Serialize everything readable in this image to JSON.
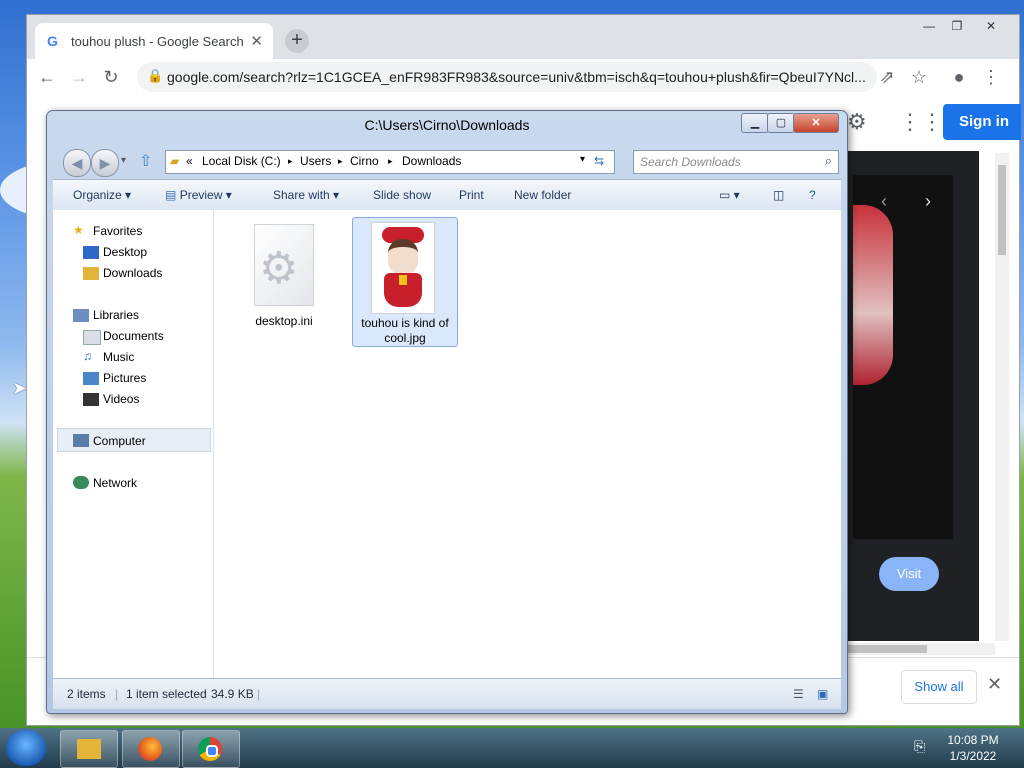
{
  "browser": {
    "tab_title": "touhou plush - Google Search",
    "tab_close": "✕",
    "new_tab": "+",
    "url": "google.com/search?rlz=1C1GCEA_enFR983FR983&source=univ&tbm=isch&q=touhou+plush&fir=QbeuI7YNcl...",
    "sign_in": "Sign in",
    "visit_button": "Visit",
    "show_all": "Show all",
    "download_close": "✕"
  },
  "explorer": {
    "title": "C:\\Users\\Cirno\\Downloads",
    "breadcrumb": [
      "Local Disk (C:)",
      "Users",
      "Cirno",
      "Downloads"
    ],
    "breadcrumb_sep": "▸",
    "breadcrumb_prefix": "«",
    "search_placeholder": "Search Downloads",
    "toolbar": {
      "organize": "Organize ▾",
      "preview": "Preview ▾",
      "share_with": "Share with ▾",
      "slide_show": "Slide show",
      "print": "Print",
      "new_folder": "New folder"
    },
    "nav": {
      "favorites": "Favorites",
      "desktop": "Desktop",
      "downloads": "Downloads",
      "libraries": "Libraries",
      "documents": "Documents",
      "music": "Music",
      "pictures": "Pictures",
      "videos": "Videos",
      "computer": "Computer",
      "network": "Network"
    },
    "files": [
      {
        "name": "desktop.ini",
        "selected": false
      },
      {
        "name": "touhou is kind of cool.jpg",
        "selected": true
      }
    ],
    "status": {
      "count": "2 items",
      "selection": "1 item selected",
      "size": "34.9 KB"
    }
  },
  "taskbar": {
    "time": "10:08 PM",
    "date": "1/3/2022"
  },
  "colors": {
    "chrome_accent": "#1a73e8",
    "explorer_frame": "#b4c8e4",
    "selection": "#d9e8fb"
  }
}
